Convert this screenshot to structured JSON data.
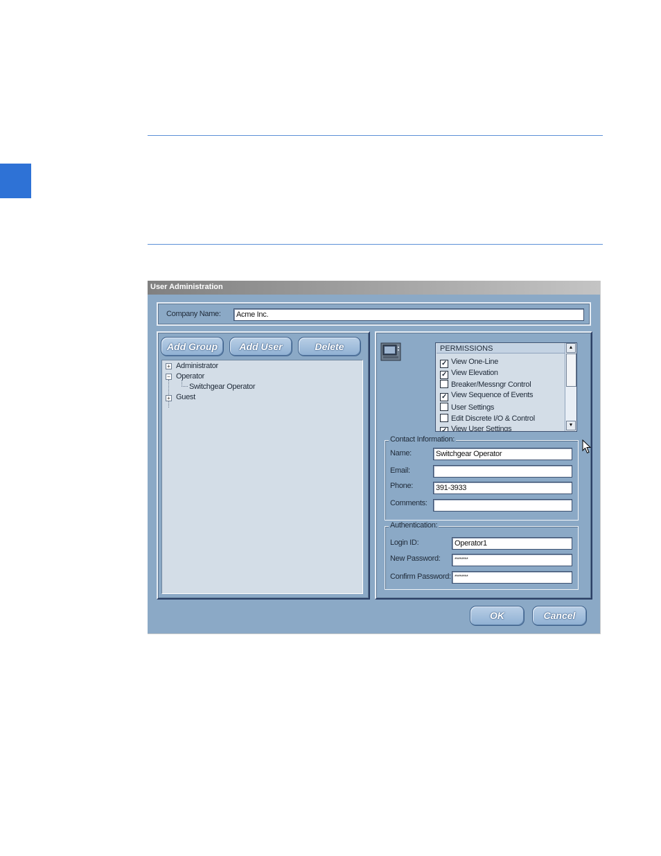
{
  "dialog": {
    "title": "User Administration",
    "company_label": "Company Name:",
    "company_value": "Acme Inc."
  },
  "left": {
    "buttons": {
      "add_group": "Add Group",
      "add_user": "Add User",
      "delete": "Delete"
    },
    "tree": [
      {
        "label": "Administrator",
        "expander": "+"
      },
      {
        "label": "Operator",
        "expander": "−"
      },
      {
        "label": "Switchgear Operator"
      },
      {
        "label": "Guest",
        "expander": "+"
      }
    ]
  },
  "permissions": {
    "header": "PERMISSIONS",
    "items": [
      {
        "label": "View One-Line",
        "checked": "✓"
      },
      {
        "label": "View Elevation",
        "checked": "✓"
      },
      {
        "label": "Breaker/Messngr Control",
        "checked": ""
      },
      {
        "label": "View Sequence of Events",
        "checked": "✓"
      },
      {
        "label": "User Settings",
        "checked": ""
      },
      {
        "label": "Edit Discrete I/O & Control",
        "checked": ""
      },
      {
        "label": "View User Settings",
        "checked": "✓"
      }
    ]
  },
  "contact": {
    "legend": "Contact Information:",
    "name_label": "Name:",
    "name_value": "Switchgear Operator",
    "email_label": "Email:",
    "email_value": "",
    "phone_label": "Phone:",
    "phone_value": "391-3933",
    "comments_label": "Comments:",
    "comments_value": ""
  },
  "auth": {
    "legend": "Authentication:",
    "login_label": "Login ID:",
    "login_value": "Operator1",
    "newpw_label": "New Password:",
    "newpw_value": "********",
    "confirmpw_label": "Confirm Password:",
    "confirmpw_value": "********"
  },
  "footer": {
    "ok": "OK",
    "cancel": "Cancel"
  },
  "icons": [
    "monitor-icon",
    "mouse-cursor-icon"
  ]
}
